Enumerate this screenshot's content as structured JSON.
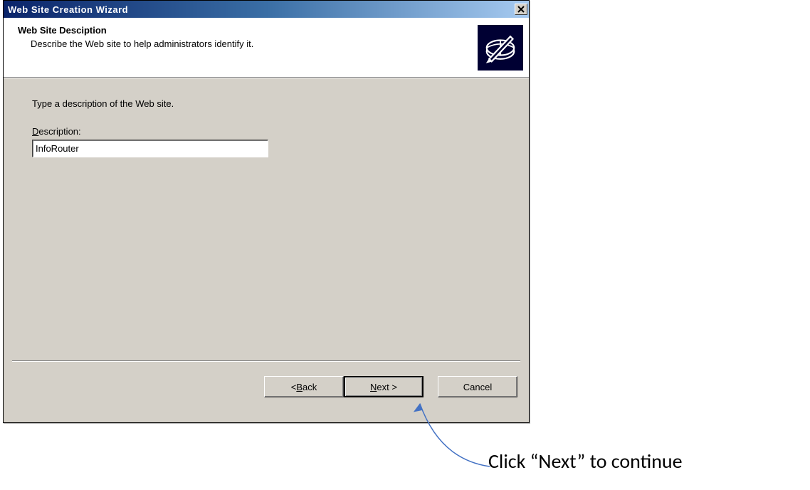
{
  "window": {
    "title": "Web Site Creation Wizard"
  },
  "header": {
    "title": "Web Site Desciption",
    "subtitle": "Describe the Web site to help administrators identify it."
  },
  "content": {
    "prompt": "Type a description of the Web site.",
    "field_label_prefix": "D",
    "field_label_rest": "escription:",
    "input_value": "InfoRouter"
  },
  "buttons": {
    "back_lt": "< ",
    "back_underline": "B",
    "back_rest": "ack",
    "next_underline": "N",
    "next_rest": "ext >",
    "cancel": "Cancel"
  },
  "annotation": {
    "text": "Click “Next” to continue"
  }
}
